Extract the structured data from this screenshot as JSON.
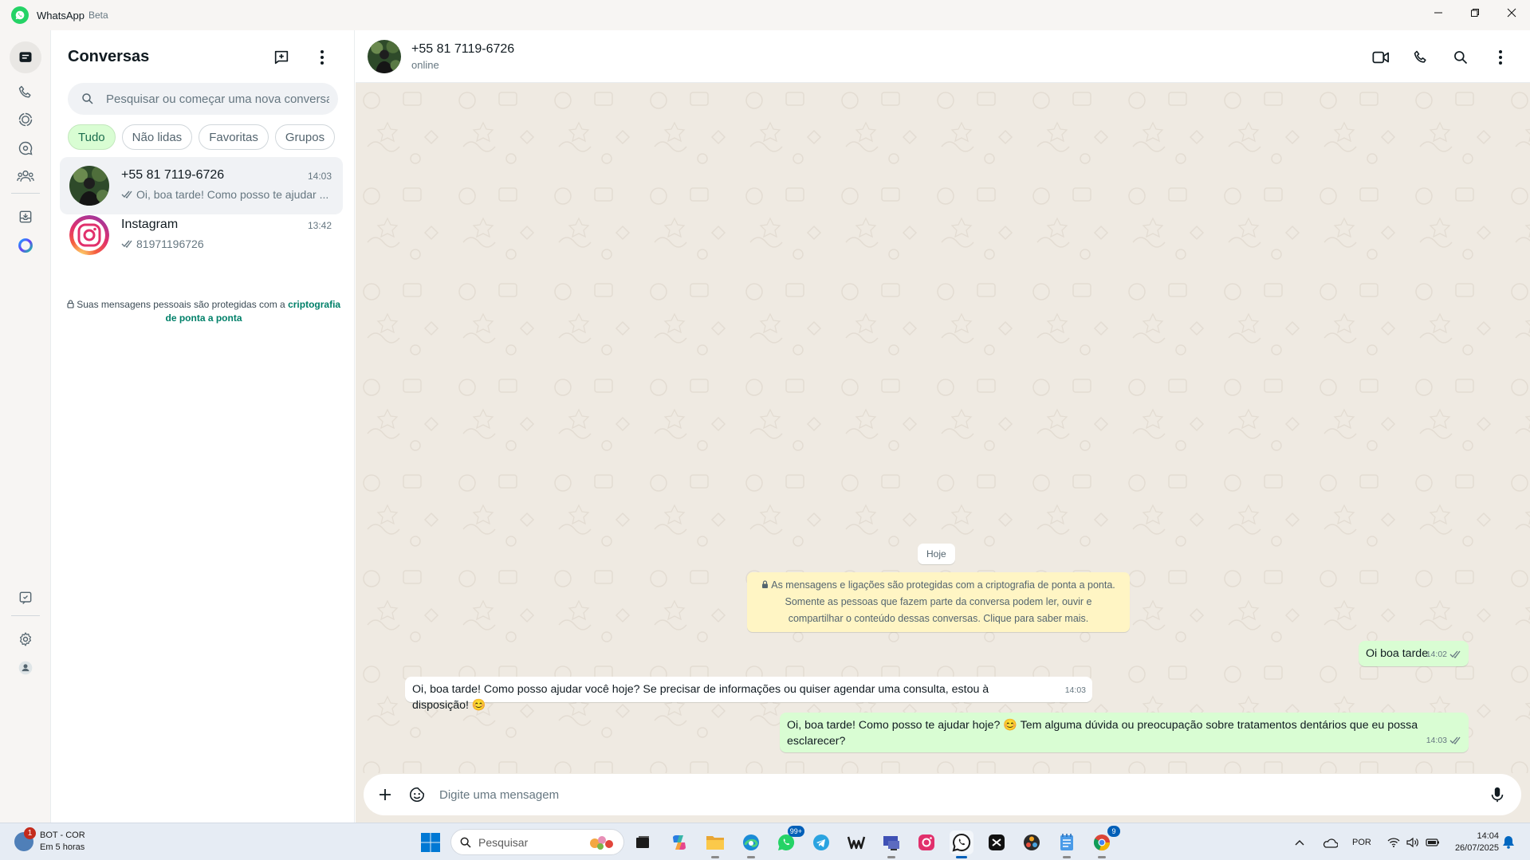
{
  "titlebar": {
    "app_name": "WhatsApp",
    "app_suffix": "Beta"
  },
  "rail": {
    "items": [
      "chats",
      "calls",
      "status",
      "channels",
      "communities",
      "archived",
      "meta-ai",
      "starred",
      "settings",
      "profile"
    ]
  },
  "panel": {
    "title": "Conversas",
    "search_placeholder": "Pesquisar ou começar uma nova conversa",
    "filters": [
      {
        "label": "Tudo",
        "active": true
      },
      {
        "label": "Não lidas",
        "active": false
      },
      {
        "label": "Favoritas",
        "active": false
      },
      {
        "label": "Grupos",
        "active": false
      }
    ],
    "chats": [
      {
        "name": "+55 81 7119-6726",
        "time": "14:03",
        "preview": "Oi, boa tarde! Como posso te ajudar ..."
      },
      {
        "name": "Instagram",
        "time": "13:42",
        "preview": "81971196726"
      }
    ],
    "e2e_note_text": "Suas mensagens pessoais são protegidas com a",
    "e2e_note_link": "criptografia de ponta a ponta"
  },
  "conversation": {
    "name": "+55 81 7119-6726",
    "status": "online",
    "date_chip": "Hoje",
    "system_message": "As mensagens e ligações são protegidas com a criptografia de ponta a ponta. Somente as pessoas que fazem parte da conversa podem ler, ouvir e compartilhar o conteúdo dessas conversas. Clique para saber mais.",
    "messages": [
      {
        "direction": "out",
        "text": "Oi boa tarde",
        "time": "14:02"
      },
      {
        "direction": "in",
        "text": "Oi, boa tarde! Como posso ajudar você hoje? Se precisar de informações ou quiser agendar uma consulta, estou à disposição! 😊",
        "time": "14:03"
      },
      {
        "direction": "out",
        "text": "Oi, boa tarde! Como posso te ajudar hoje? 😊 Tem alguma dúvida ou preocupação sobre tratamentos dentários que eu possa esclarecer?",
        "time": "14:03"
      }
    ],
    "composer_placeholder": "Digite uma mensagem"
  },
  "taskbar": {
    "weather_badge": "1",
    "weather_title": "BOT - COR",
    "weather_subtitle": "Em 5 horas",
    "search_label": "Pesquisar",
    "whatsapp_badge": "99+",
    "chrome_badge": "9",
    "language": "POR",
    "time": "14:04",
    "date": "26/07/2025"
  },
  "colors": {
    "accent": "#25d366",
    "bubble_out": "#d9fdd3",
    "chat_bg": "#efeae2",
    "link": "#008069"
  }
}
